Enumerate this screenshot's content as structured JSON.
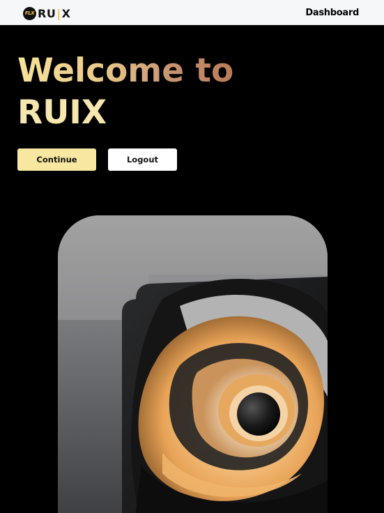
{
  "header": {
    "logo_badge": "FLX",
    "logo_text_left": "RU",
    "logo_text_bar": "|",
    "logo_text_right": "X",
    "nav_link": "Dashboard"
  },
  "hero": {
    "title_line1": "Welcome to",
    "title_line2": "RUIX"
  },
  "actions": {
    "continue_label": "Continue",
    "logout_label": "Logout"
  },
  "colors": {
    "background": "#000000",
    "accent": "#f7e7a1",
    "title_gradient_start": "#f7e39a",
    "title_gradient_end": "#b97b5a"
  },
  "image": {
    "icon": "abstract-3d-swirl-artwork"
  }
}
